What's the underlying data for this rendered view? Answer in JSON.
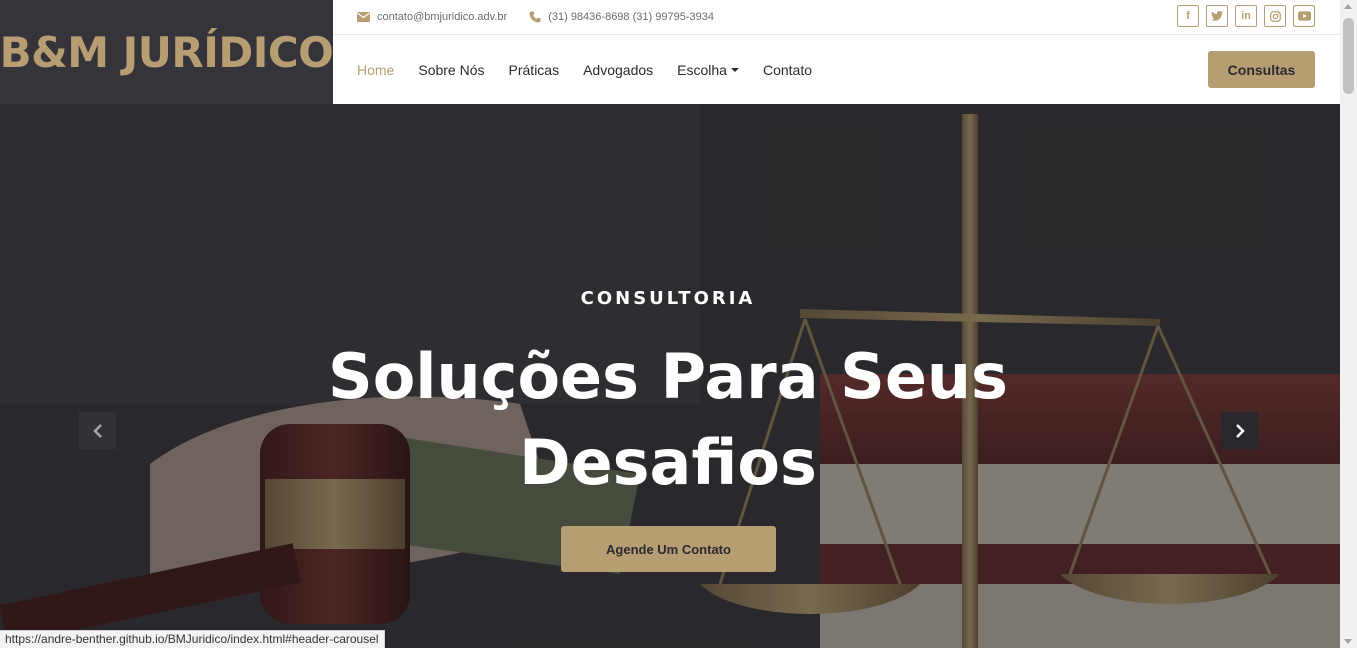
{
  "logo": {
    "text": "B&M JURÍDICO"
  },
  "topbar": {
    "email": "contato@bmjuridico.adv.br",
    "phones": "(31) 98436-8698 (31) 99795-3934",
    "socials": [
      {
        "icon": "facebook-icon",
        "glyph": "f"
      },
      {
        "icon": "twitter-icon",
        "glyph": "t"
      },
      {
        "icon": "linkedin-icon",
        "glyph": "in"
      },
      {
        "icon": "instagram-icon",
        "glyph": "◎"
      },
      {
        "icon": "youtube-icon",
        "glyph": "▶"
      }
    ]
  },
  "nav": {
    "items": [
      {
        "label": "Home",
        "active": true
      },
      {
        "label": "Sobre Nós"
      },
      {
        "label": "Práticas"
      },
      {
        "label": "Advogados"
      },
      {
        "label": "Escolha",
        "dropdown": true
      },
      {
        "label": "Contato"
      }
    ],
    "cta_label": "Consultas"
  },
  "hero": {
    "subtitle": "CONSULTORIA",
    "title": "Soluções Para Seus Desafios",
    "button_label": "Agende Um Contato"
  },
  "status_bar": {
    "url": "https://andre-benther.github.io/BMJuridico/index.html#header-carousel"
  },
  "colors": {
    "accent": "#b79e72",
    "dark": "#2b2a30",
    "logo_bg": "#35343b"
  }
}
